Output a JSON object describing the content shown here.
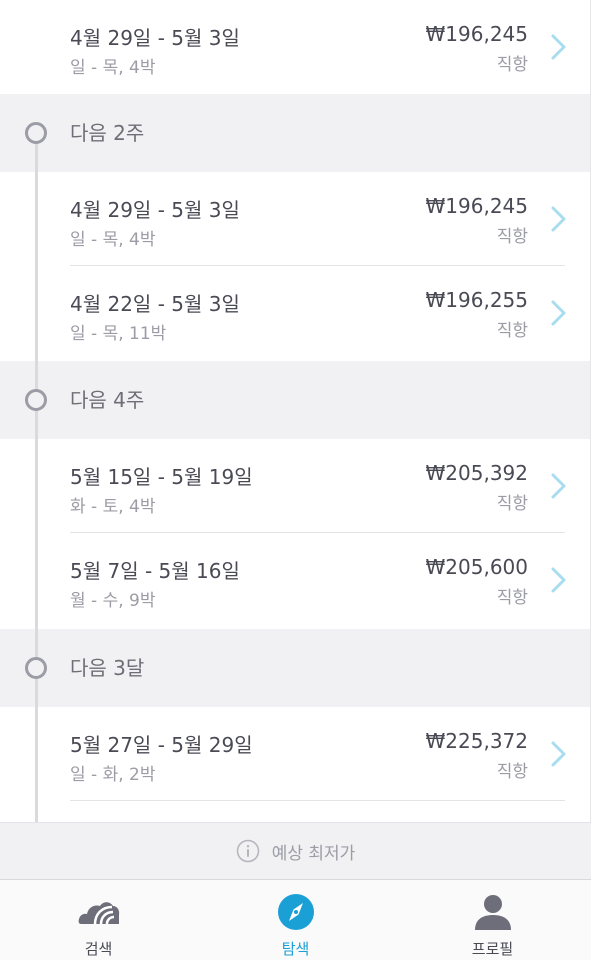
{
  "top_result": {
    "dates": "4월 29일 - 5월 3일",
    "days": "일 - 목, 4박",
    "price": "₩196,245",
    "direct": "직항"
  },
  "sections": [
    {
      "label": "다음 2주",
      "results": [
        {
          "dates": "4월 29일 - 5월 3일",
          "days": "일 - 목, 4박",
          "price": "₩196,245",
          "direct": "직항"
        },
        {
          "dates": "4월 22일 - 5월 3일",
          "days": "일 - 목, 11박",
          "price": "₩196,255",
          "direct": "직항"
        }
      ]
    },
    {
      "label": "다음 4주",
      "results": [
        {
          "dates": "5월 15일 - 5월 19일",
          "days": "화 - 토, 4박",
          "price": "₩205,392",
          "direct": "직항"
        },
        {
          "dates": "5월 7일 - 5월 16일",
          "days": "월 - 수, 9박",
          "price": "₩205,600",
          "direct": "직항"
        }
      ]
    },
    {
      "label": "다음 3달",
      "results": [
        {
          "dates": "5월 27일 - 5월 29일",
          "days": "일 - 화, 2박",
          "price": "₩225,372",
          "direct": "직항"
        }
      ]
    }
  ],
  "banner": {
    "icon": "info-icon",
    "text": "예상 최저가"
  },
  "tabbar": {
    "tabs": [
      {
        "label": "검색",
        "icon": "cloud-icon",
        "active": false
      },
      {
        "label": "탐색",
        "icon": "compass-icon",
        "active": true
      },
      {
        "label": "프로필",
        "icon": "profile-icon",
        "active": false
      }
    ]
  },
  "colors": {
    "accent": "#1aa0d4",
    "chevron": "#a8dcef",
    "section_bg": "#f1f1f3",
    "text_primary": "#4a4a55",
    "text_secondary": "#9c9ca6"
  }
}
